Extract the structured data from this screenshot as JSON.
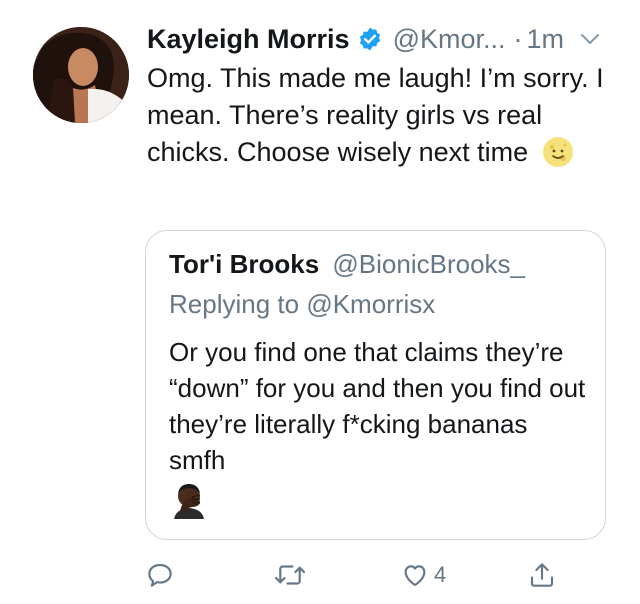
{
  "tweet": {
    "author_name": "Kayleigh Morris",
    "handle": "@Kmor...",
    "separator": "·",
    "time": "1m",
    "text": "Omg. This made me laugh! I’m sorry. I mean. There’s reality girls vs real chicks. Choose wisely next time",
    "text_emoji": "slightly-smiling-moon-emoji",
    "verified_icon": "verified-badge-icon",
    "menu_icon": "chevron-down-icon"
  },
  "quoted_tweet": {
    "author_name": "Tor'i Brooks",
    "handle": "@BionicBrooks_",
    "replying_to_prefix": "Replying to",
    "replying_to_handle": "@Kmorrisx",
    "text": "Or you find one that claims they’re “down” for you and then you find out they’re literally f*cking bananas smfh",
    "emoji": "facepalm-emoji"
  },
  "actions": {
    "reply_icon": "reply-icon",
    "retweet_icon": "retweet-icon",
    "like_icon": "heart-icon",
    "like_count": "4",
    "share_icon": "share-icon"
  },
  "colors": {
    "text": "#14171a",
    "secondary": "#657786",
    "verified": "#1da1f2",
    "border": "#ccd6dd"
  }
}
